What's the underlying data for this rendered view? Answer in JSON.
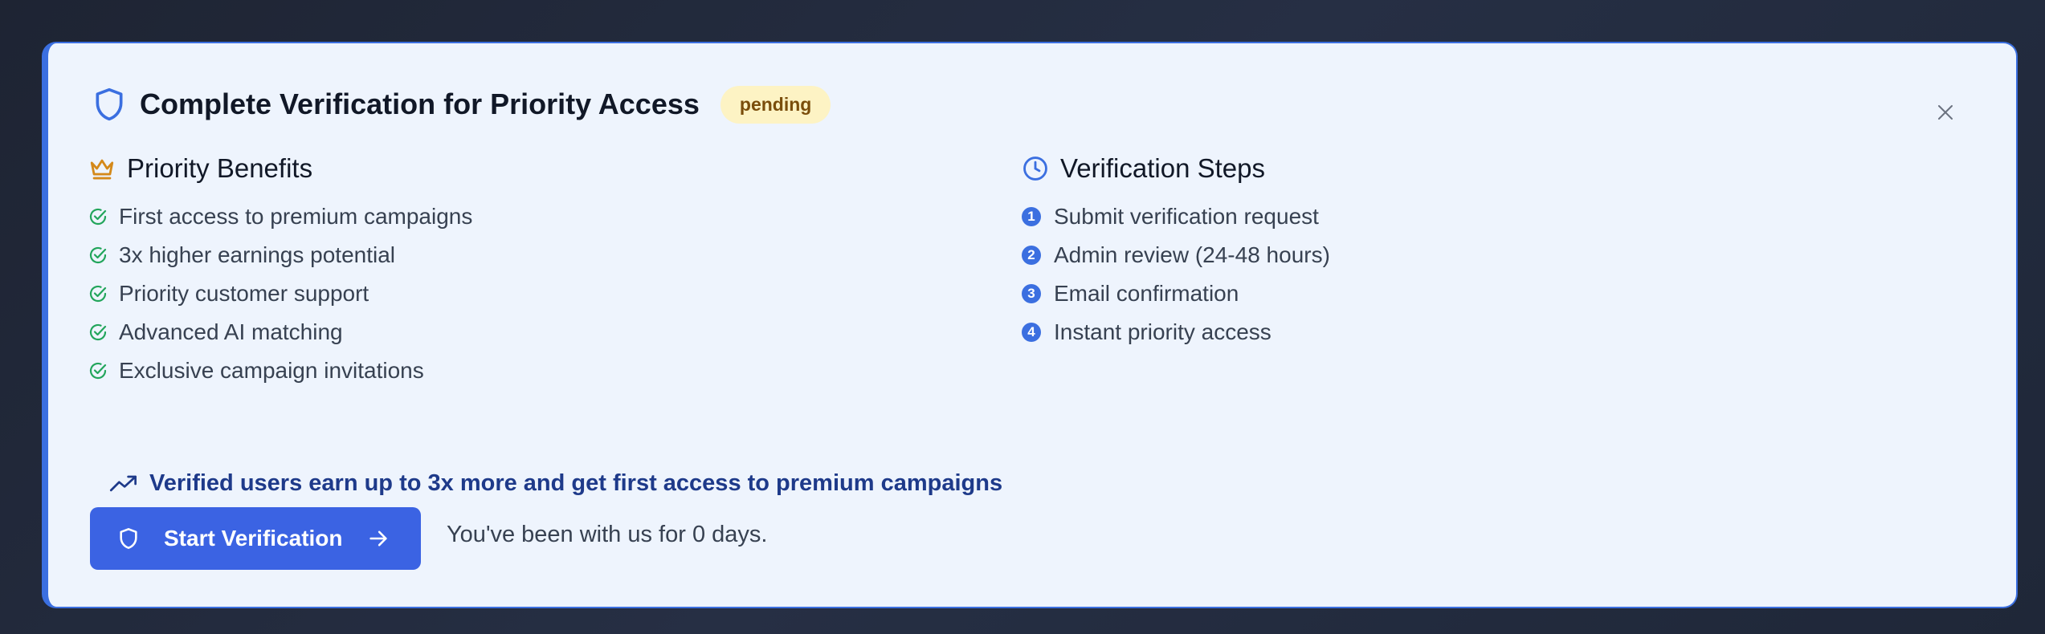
{
  "header": {
    "title": "Complete Verification for Priority Access",
    "status_badge": "pending",
    "shield_icon": "shield-icon",
    "close_icon": "close-icon"
  },
  "benefits": {
    "title": "Priority Benefits",
    "icon": "crown-icon",
    "items": [
      "First access to premium campaigns",
      "3x higher earnings potential",
      "Priority customer support",
      "Advanced AI matching",
      "Exclusive campaign invitations"
    ]
  },
  "steps": {
    "title": "Verification Steps",
    "icon": "clock-icon",
    "items": [
      {
        "num": "1",
        "label": "Submit verification request"
      },
      {
        "num": "2",
        "label": "Admin review (24-48 hours)"
      },
      {
        "num": "3",
        "label": "Email confirmation"
      },
      {
        "num": "4",
        "label": "Instant priority access"
      }
    ]
  },
  "promo": {
    "text": "Verified users earn up to 3x more and get first access to premium campaigns",
    "icon": "trending-up-icon"
  },
  "cta": {
    "button_label": "Start Verification",
    "tenure_text": "You've been with us for 0 days."
  },
  "colors": {
    "accent": "#3b6fe0",
    "card_bg": "#eef4fd",
    "badge_bg": "#fdf3c4",
    "check_green": "#22a55b",
    "crown_gold": "#d4891a"
  }
}
